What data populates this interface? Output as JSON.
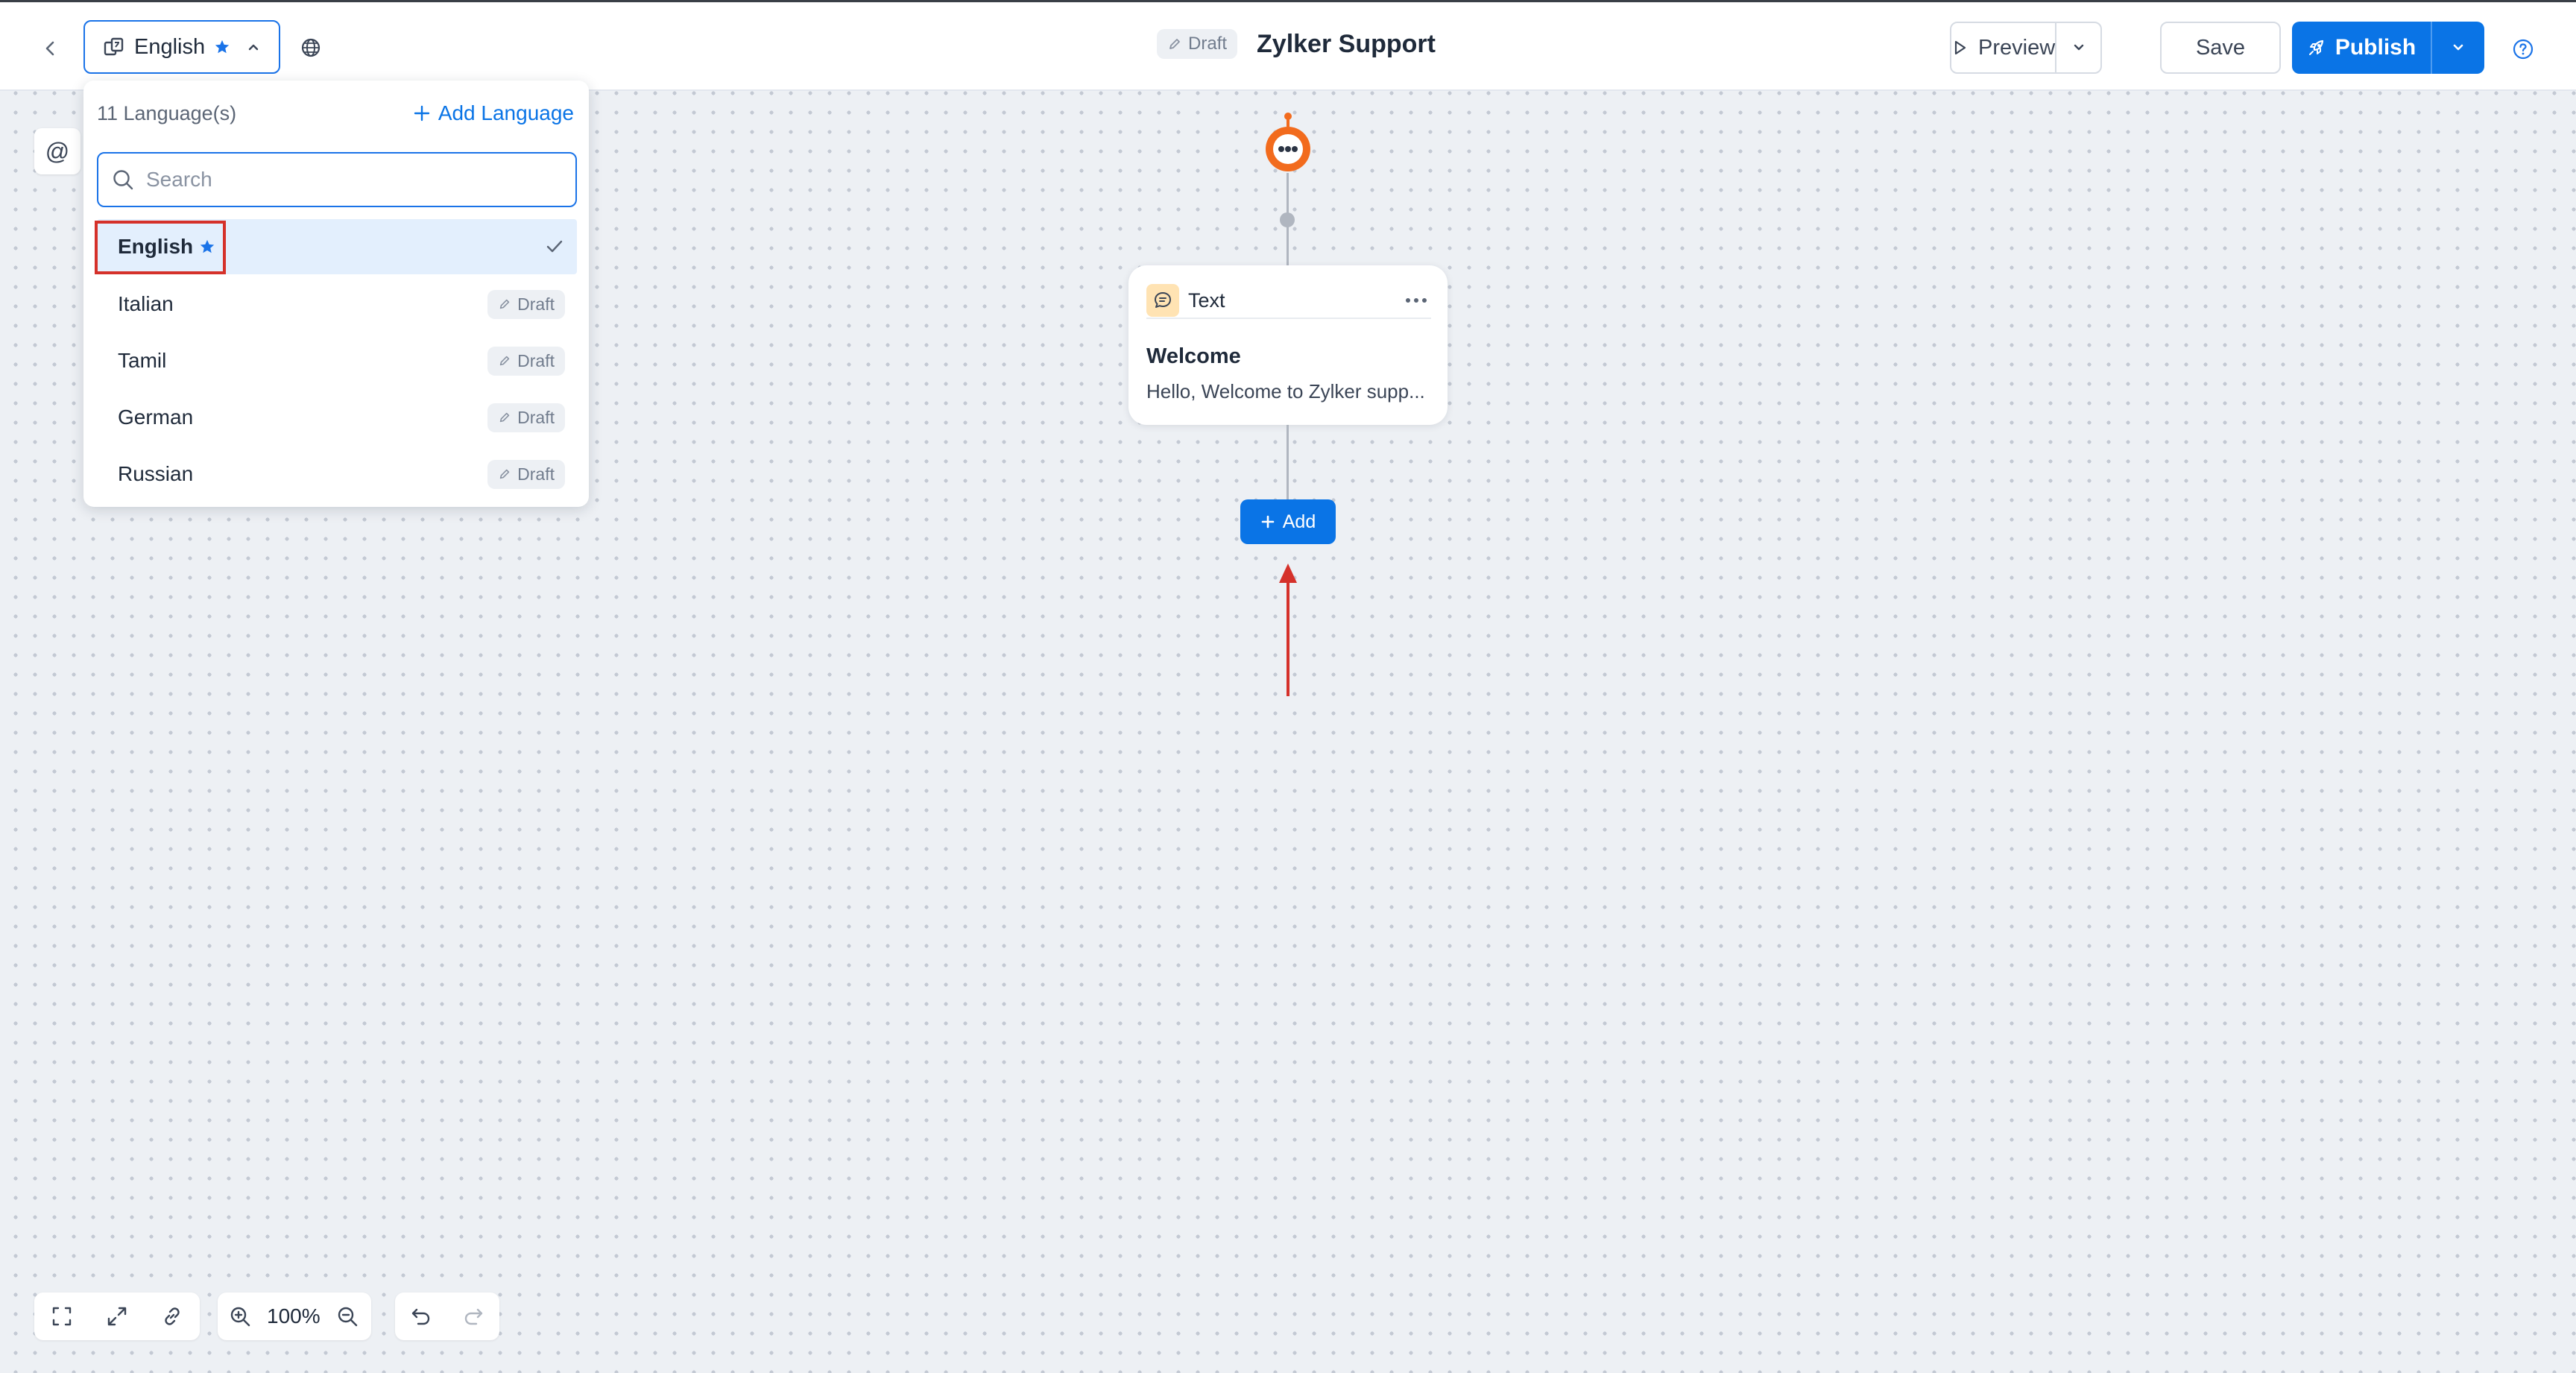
{
  "header": {
    "current_language": "English",
    "status_badge": "Draft",
    "bot_name": "Zylker Support",
    "preview_label": "Preview",
    "save_label": "Save",
    "publish_label": "Publish"
  },
  "language_panel": {
    "count_label": "11 Language(s)",
    "add_language_label": "Add Language",
    "search_placeholder": "Search",
    "items": [
      {
        "name": "English",
        "primary": true,
        "selected": true
      },
      {
        "name": "Italian",
        "status": "Draft"
      },
      {
        "name": "Tamil",
        "status": "Draft"
      },
      {
        "name": "German",
        "status": "Draft"
      },
      {
        "name": "Russian",
        "status": "Draft"
      }
    ]
  },
  "flow": {
    "card": {
      "type_label": "Text",
      "title": "Welcome",
      "preview_text": "Hello, Welcome to Zylker supp..."
    },
    "add_label": "Add"
  },
  "toolbar": {
    "zoom_level": "100%"
  },
  "colors": {
    "accent": "#0a74e6",
    "bot_orange": "#f26b1d",
    "annotation_red": "#d5312a"
  }
}
